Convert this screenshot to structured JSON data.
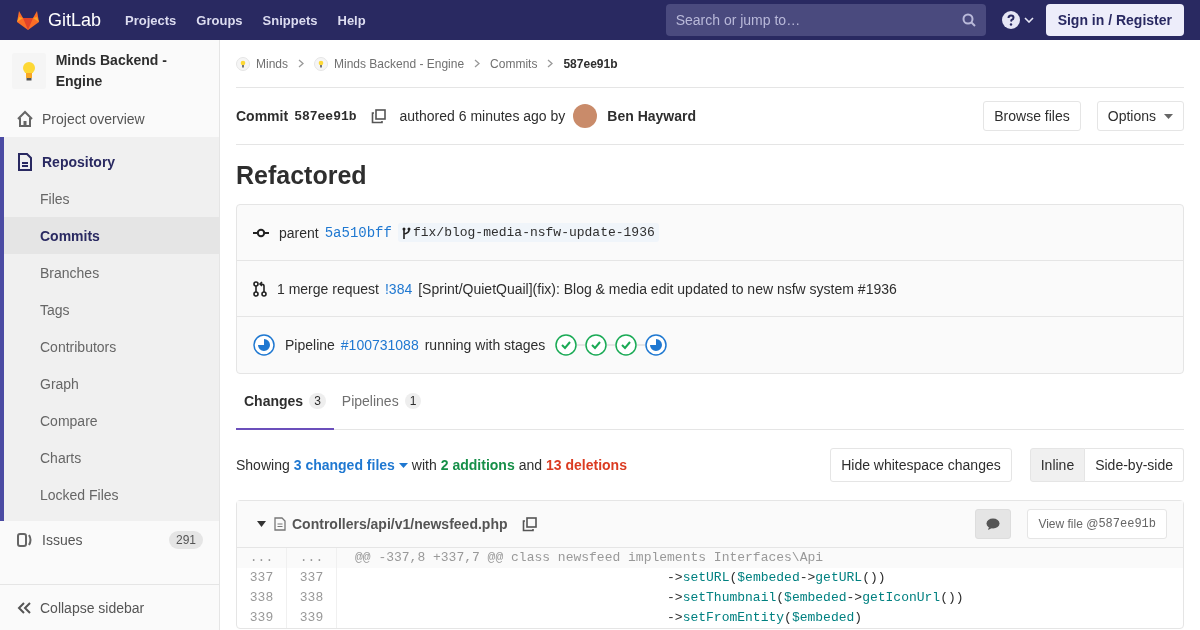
{
  "topbar": {
    "logo": "GitLab",
    "nav": [
      "Projects",
      "Groups",
      "Snippets",
      "Help"
    ],
    "search": {
      "placeholder": "Search or jump to…"
    },
    "sign_in": "Sign in / Register"
  },
  "sidebar": {
    "project": "Minds Backend - Engine",
    "nav": [
      {
        "label": "Project overview",
        "kind": "home",
        "selected": false
      },
      {
        "label": "Repository",
        "kind": "repository",
        "selected": true,
        "expanded": true,
        "children": [
          {
            "label": "Files",
            "selected": false
          },
          {
            "label": "Commits",
            "selected": true
          },
          {
            "label": "Branches",
            "selected": false
          },
          {
            "label": "Tags",
            "selected": false
          },
          {
            "label": "Contributors",
            "selected": false
          },
          {
            "label": "Graph",
            "selected": false
          },
          {
            "label": "Compare",
            "selected": false
          },
          {
            "label": "Charts",
            "selected": false
          },
          {
            "label": "Locked Files",
            "selected": false
          }
        ]
      },
      {
        "label": "Issues",
        "kind": "issues",
        "selected": false,
        "count": "291"
      }
    ],
    "collapse": "Collapse sidebar"
  },
  "breadcrumbs": [
    {
      "label": "Minds",
      "kind": "project"
    },
    {
      "label": "Minds Backend - Engine",
      "kind": "project"
    },
    {
      "label": "Commits",
      "kind": "plain"
    },
    {
      "label": "587ee91b",
      "kind": "current"
    }
  ],
  "commit": {
    "label": "Commit",
    "sha": "587ee91b",
    "authored": "authored 6 minutes ago by",
    "author": "Ben Hayward",
    "buttons": [
      "Browse files",
      "Options"
    ],
    "title": "Refactored"
  },
  "info": {
    "parent_label": "parent",
    "parent_sha": "5a510bff",
    "branch": "fix/blog-media-nsfw-update-1936",
    "mr_count": "1 merge request",
    "mr_link": "!384",
    "mr_title": "[Sprint/QuietQuail](fix): Blog & media edit updated to new nsfw system #1936",
    "pipeline": {
      "kind": "running",
      "label": "Pipeline",
      "link": "#100731088",
      "text": "running with stages",
      "stages": [
        {
          "kind": "success"
        },
        {
          "kind": "success"
        },
        {
          "kind": "success"
        },
        {
          "kind": "running"
        }
      ]
    }
  },
  "tabs": [
    {
      "label": "Changes",
      "count": "3",
      "selected": true
    },
    {
      "label": "Pipelines",
      "count": "1",
      "selected": false
    }
  ],
  "summary": {
    "showing": "Showing",
    "files": "3 changed files",
    "with": "with",
    "additions": "2 additions",
    "and": "and",
    "deletions": "13 deletions",
    "whitespace_button": "Hide whitespace changes",
    "views": [
      {
        "label": "Inline",
        "selected": true
      },
      {
        "label": "Side-by-side",
        "selected": false
      }
    ]
  },
  "file": {
    "expanded": true,
    "path": "Controllers/api/v1/newsfeed.php",
    "view_file": "View file @",
    "sha": "587ee91b",
    "lines": [
      {
        "kind": "match",
        "old": "...",
        "new": "...",
        "tokens": [
          {
            "kind": "plain",
            "text": "@@ -337,8 +337,7 @@ class newsfeed implements Interfaces\\Api"
          }
        ]
      },
      {
        "kind": "context",
        "old": "337",
        "new": "337",
        "tokens": [
          {
            "kind": "plain",
            "text": "                                        ->"
          },
          {
            "kind": "name",
            "text": "setURL"
          },
          {
            "kind": "plain",
            "text": "("
          },
          {
            "kind": "var",
            "text": "$embeded"
          },
          {
            "kind": "plain",
            "text": "->"
          },
          {
            "kind": "name",
            "text": "getURL"
          },
          {
            "kind": "plain",
            "text": "())"
          }
        ]
      },
      {
        "kind": "context",
        "old": "338",
        "new": "338",
        "tokens": [
          {
            "kind": "plain",
            "text": "                                        ->"
          },
          {
            "kind": "name",
            "text": "setThumbnail"
          },
          {
            "kind": "plain",
            "text": "("
          },
          {
            "kind": "var",
            "text": "$embeded"
          },
          {
            "kind": "plain",
            "text": "->"
          },
          {
            "kind": "name",
            "text": "getIconUrl"
          },
          {
            "kind": "plain",
            "text": "())"
          }
        ]
      },
      {
        "kind": "context",
        "old": "339",
        "new": "339",
        "tokens": [
          {
            "kind": "plain",
            "text": "                                        ->"
          },
          {
            "kind": "name",
            "text": "setFromEntity"
          },
          {
            "kind": "plain",
            "text": "("
          },
          {
            "kind": "var",
            "text": "$embeded"
          },
          {
            "kind": "plain",
            "text": ")"
          }
        ]
      }
    ]
  }
}
